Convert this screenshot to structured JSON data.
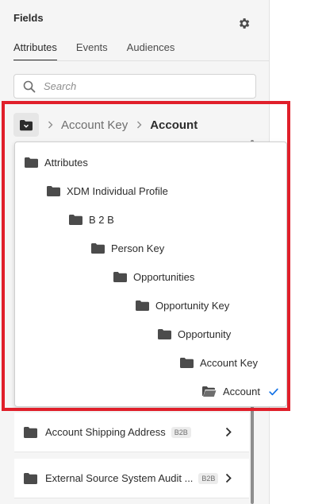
{
  "panel": {
    "title": "Fields"
  },
  "tabs": [
    {
      "label": "Attributes",
      "active": true
    },
    {
      "label": "Events",
      "active": false
    },
    {
      "label": "Audiences",
      "active": false
    }
  ],
  "search": {
    "placeholder": "Search",
    "value": ""
  },
  "breadcrumb": {
    "items": [
      {
        "label": "Account Key",
        "current": false
      },
      {
        "label": "Account",
        "current": true
      }
    ]
  },
  "dropdown": {
    "items": [
      {
        "label": "Attributes",
        "level": 0
      },
      {
        "label": "XDM Individual Profile",
        "level": 1
      },
      {
        "label": "B 2 B",
        "level": 2
      },
      {
        "label": "Person Key",
        "level": 3
      },
      {
        "label": "Opportunities",
        "level": 4
      },
      {
        "label": "Opportunity Key",
        "level": 5
      },
      {
        "label": "Opportunity",
        "level": 6
      },
      {
        "label": "Account Key",
        "level": 7
      },
      {
        "label": "Account",
        "level": 8,
        "selected": true,
        "open": true
      }
    ]
  },
  "list": [
    {
      "label": "Account Shipping Address",
      "badge": "B2B"
    },
    {
      "label": "External Source System Audit ...",
      "badge": "B2B"
    }
  ],
  "colors": {
    "highlight": "#e01f2a",
    "check": "#1473e6",
    "folder": "#4b4b4b"
  },
  "icons": {
    "settings": "gear-icon",
    "search": "search-icon",
    "folder": "folder-icon",
    "open_folder": "folder-open-icon",
    "separator": "chevron-right-icon",
    "selected": "checkmark-icon"
  }
}
